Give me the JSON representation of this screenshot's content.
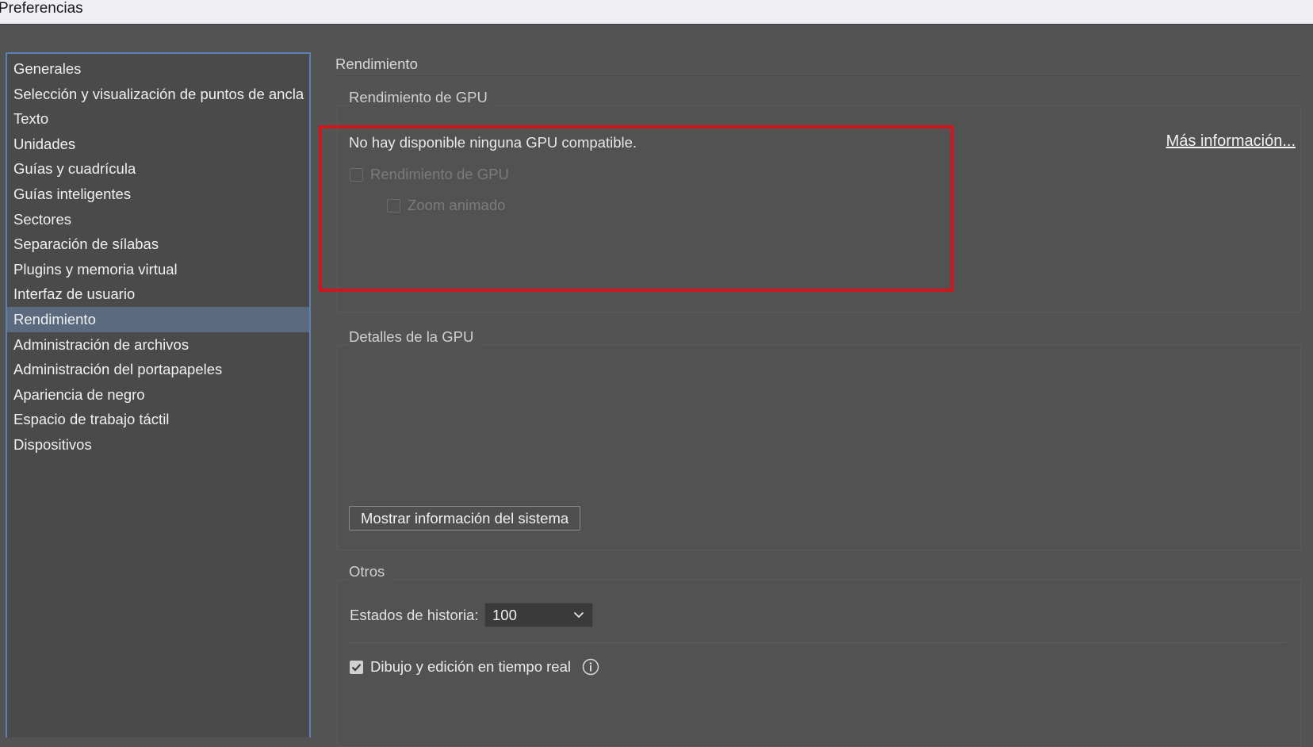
{
  "window": {
    "title": "Preferencias"
  },
  "sidebar": {
    "items": [
      {
        "label": "Generales"
      },
      {
        "label": "Selección y visualización de puntos de ancla"
      },
      {
        "label": "Texto"
      },
      {
        "label": "Unidades"
      },
      {
        "label": "Guías y cuadrícula"
      },
      {
        "label": "Guías inteligentes"
      },
      {
        "label": "Sectores"
      },
      {
        "label": "Separación de sílabas"
      },
      {
        "label": "Plugins y memoria virtual"
      },
      {
        "label": "Interfaz de usuario"
      },
      {
        "label": "Rendimiento",
        "active": true
      },
      {
        "label": "Administración de archivos"
      },
      {
        "label": "Administración del portapapeles"
      },
      {
        "label": "Apariencia de negro"
      },
      {
        "label": "Espacio de trabajo táctil"
      },
      {
        "label": "Dispositivos"
      }
    ]
  },
  "main": {
    "section_title": "Rendimiento",
    "gpu_group": {
      "label": "Rendimiento de GPU",
      "message": "No hay disponible ninguna GPU compatible.",
      "more_info_link": "Más información...",
      "gpu_performance_checkbox": {
        "label": "Rendimiento de GPU",
        "checked": false,
        "disabled": true
      },
      "animated_zoom_checkbox": {
        "label": "Zoom animado",
        "checked": false,
        "disabled": true
      },
      "highlight_color": "#d0161c"
    },
    "gpu_details_group": {
      "label": "Detalles de la GPU",
      "system_info_button": "Mostrar información del sistema"
    },
    "others_group": {
      "label": "Otros",
      "history_states_label": "Estados de historia:",
      "history_states_value": "100",
      "live_drawing_checkbox": {
        "label": "Dibujo y edición en tiempo real",
        "checked": true
      }
    }
  },
  "icons": {
    "chevron": "chevron-down-icon",
    "info": "info-icon",
    "check": "check-icon"
  }
}
